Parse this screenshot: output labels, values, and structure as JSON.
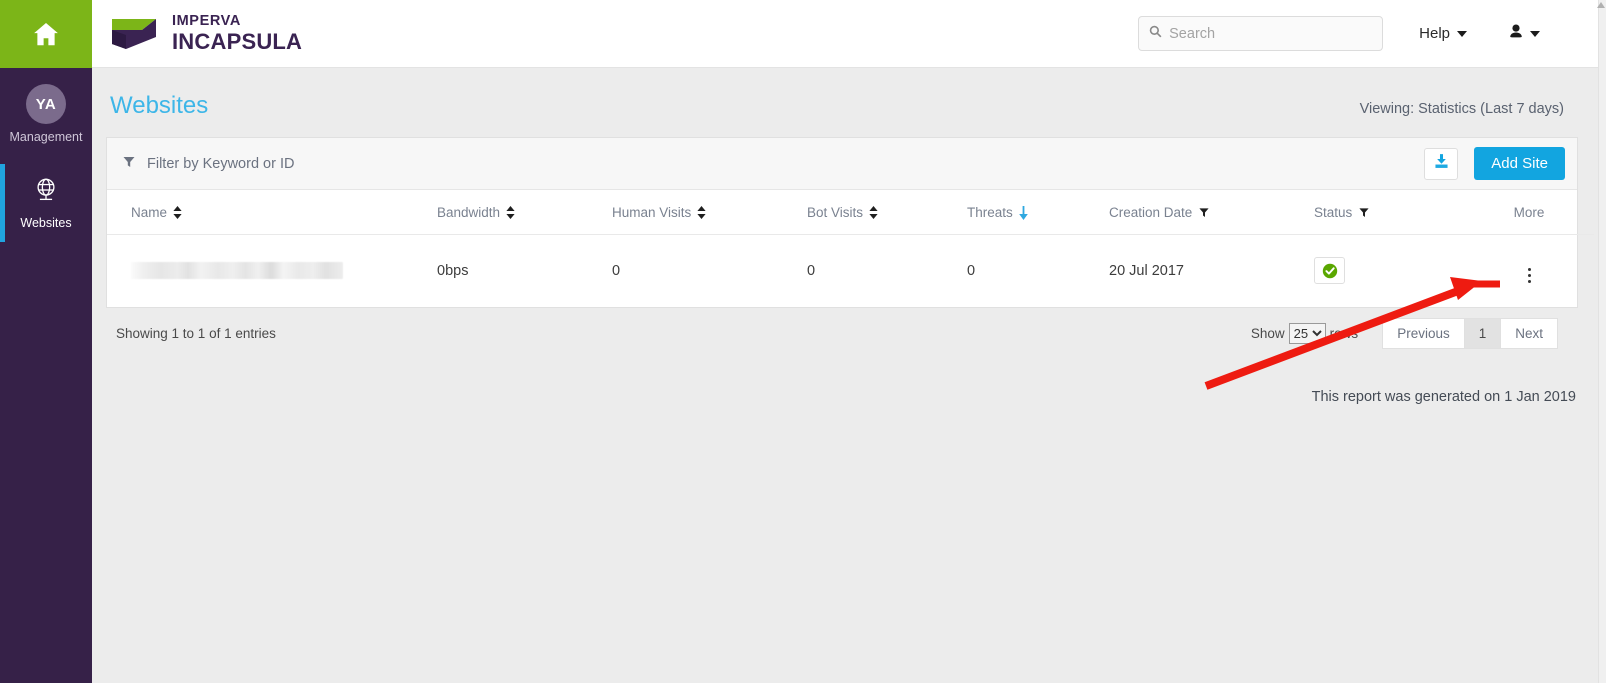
{
  "sidebar": {
    "home_icon": "home-icon",
    "items": [
      {
        "avatar_initials": "YA",
        "label": "Management",
        "icon": "avatar-icon",
        "active": false
      },
      {
        "label": "Websites",
        "icon": "globe-icon",
        "active": true
      }
    ]
  },
  "topbar": {
    "logo_top": "IMPERVA",
    "logo_bottom": "INCAPSULA",
    "search": {
      "value": "",
      "placeholder": "Search",
      "icon": "search-icon"
    },
    "help_label": "Help",
    "user_icon": "user-icon"
  },
  "page": {
    "title": "Websites",
    "viewing": "Viewing: Statistics (Last 7 days)",
    "report_note": "This report was generated on 1 Jan 2019"
  },
  "toolbar": {
    "filter": {
      "value": "",
      "placeholder": "Filter by Keyword or ID",
      "icon": "filter-icon"
    },
    "download_icon": "download-icon",
    "add_site_label": "Add Site"
  },
  "table": {
    "columns": [
      {
        "label": "Name",
        "sort": "both"
      },
      {
        "label": "Bandwidth",
        "sort": "both"
      },
      {
        "label": "Human Visits",
        "sort": "both"
      },
      {
        "label": "Bot Visits",
        "sort": "both"
      },
      {
        "label": "Threats",
        "sort": "desc-active"
      },
      {
        "label": "Creation Date",
        "sort": "filter"
      },
      {
        "label": "Status",
        "sort": "filter"
      },
      {
        "label": "More",
        "sort": "none"
      }
    ],
    "rows": [
      {
        "name": "",
        "name_redacted": true,
        "bandwidth": "0bps",
        "human_visits": "0",
        "bot_visits": "0",
        "threats": "0",
        "creation_date": "20 Jul 2017",
        "status": "active",
        "more_icon": "kebab-menu-icon"
      }
    ]
  },
  "footer": {
    "entries_text": "Showing 1 to 1 of 1 entries",
    "show_label": "Show",
    "rows_label": "rows",
    "rows_value": "25",
    "rows_options": [
      "25"
    ],
    "previous_label": "Previous",
    "page_label": "1",
    "next_label": "Next"
  },
  "colors": {
    "brand_green": "#7cb518",
    "brand_purple": "#362148",
    "accent_blue": "#12a5e0",
    "title_blue": "#3db6e8",
    "status_green": "#5aa700",
    "annotation_red": "#ee1b11"
  },
  "annotation": {
    "type": "arrow",
    "color": "#ee1b11",
    "points_to": "More kebab menu"
  }
}
